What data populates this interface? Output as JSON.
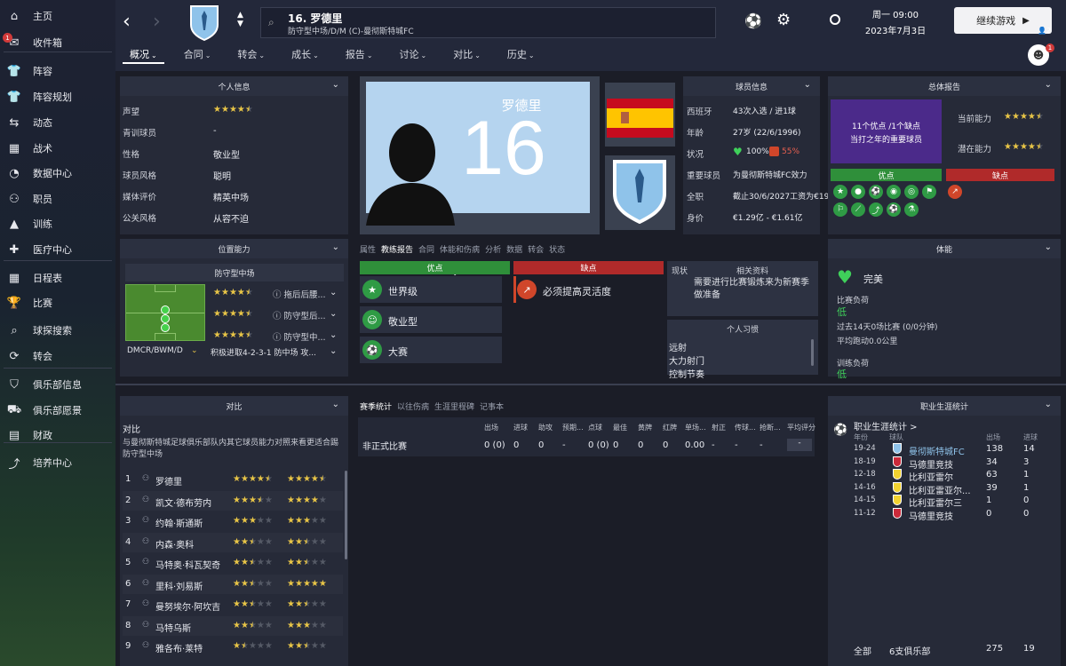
{
  "sidebar": [
    {
      "label": "主页",
      "icon": "home-icon",
      "glyph": "⌂"
    },
    {
      "label": "收件箱",
      "icon": "inbox-icon",
      "glyph": "✉",
      "badge": "1"
    },
    {
      "label": "阵容",
      "icon": "squad-icon",
      "glyph": "👕"
    },
    {
      "label": "阵容规划",
      "icon": "squad-planner-icon",
      "glyph": "👕"
    },
    {
      "label": "动态",
      "icon": "dynamics-icon",
      "glyph": "⇆"
    },
    {
      "label": "战术",
      "icon": "tactics-icon",
      "glyph": "▦"
    },
    {
      "label": "数据中心",
      "icon": "data-hub-icon",
      "glyph": "◔"
    },
    {
      "label": "职员",
      "icon": "staff-icon",
      "glyph": "⚇"
    },
    {
      "label": "训练",
      "icon": "training-icon",
      "glyph": "▲"
    },
    {
      "label": "医疗中心",
      "icon": "medical-icon",
      "glyph": "✚"
    },
    {
      "label": "日程表",
      "icon": "calendar-icon",
      "glyph": "▦"
    },
    {
      "label": "比赛",
      "icon": "trophy-icon",
      "glyph": "🏆"
    },
    {
      "label": "球探搜索",
      "icon": "scouting-icon",
      "glyph": "⌕"
    },
    {
      "label": "转会",
      "icon": "transfers-icon",
      "glyph": "⟳"
    },
    {
      "label": "俱乐部信息",
      "icon": "club-info-icon",
      "glyph": "⛉"
    },
    {
      "label": "俱乐部愿景",
      "icon": "club-vision-icon",
      "glyph": "⛟"
    },
    {
      "label": "财政",
      "icon": "finances-icon",
      "glyph": "▤"
    },
    {
      "label": "培养中心",
      "icon": "development-icon",
      "glyph": "⤴"
    }
  ],
  "header": {
    "player_name": "16. 罗德里",
    "player_sub": "防守型中场/D/M (C)-曼彻斯特城FC",
    "date_day": "周一 09:00",
    "date_full": "2023年7月3日",
    "continue": "继续游戏",
    "tabs": [
      "概况",
      "合同",
      "转会",
      "成长",
      "报告",
      "讨论",
      "对比",
      "历史"
    ]
  },
  "personal": {
    "title": "个人信息",
    "rows": [
      {
        "label": "声望",
        "value": "",
        "stars": 4.5
      },
      {
        "label": "青训球员",
        "value": "-"
      },
      {
        "label": "性格",
        "value": "敬业型"
      },
      {
        "label": "球员风格",
        "value": "聪明"
      },
      {
        "label": "媒体评价",
        "value": "精英中场"
      },
      {
        "label": "公关风格",
        "value": "从容不迫"
      }
    ]
  },
  "portrait": {
    "shirt_name": "罗德里",
    "shirt_number": "16"
  },
  "player_info": {
    "title": "球员信息",
    "rows": [
      {
        "label": "西班牙",
        "value": "43次入选 / 进1球"
      },
      {
        "label": "年龄",
        "value": "27岁 (22/6/1996)"
      },
      {
        "label": "状况",
        "value": "100%",
        "value2": "55%"
      },
      {
        "label": "重要球员",
        "value": "为曼彻斯特城FC效力"
      },
      {
        "label": "全职",
        "value": "截止30/6/2027工资为€19万/周"
      },
      {
        "label": "身价",
        "value": "€1.29亿 - €1.61亿"
      }
    ]
  },
  "overall": {
    "title": "总体报告",
    "purple_line1": "11个优点 /1个缺点",
    "purple_line2": "当打之年的重要球员",
    "current_label": "当前能力",
    "potential_label": "潜在能力",
    "current_stars": 4.5,
    "potential_stars": 4.5,
    "good": "优点",
    "bad": "缺点"
  },
  "position": {
    "title": "位置能力",
    "select": "防守型中场",
    "rows": [
      {
        "stars": 4.5,
        "role": "拖后后腰..."
      },
      {
        "stars": 4.5,
        "role": "防守型后..."
      },
      {
        "stars": 4.5,
        "role": "防守型中..."
      }
    ],
    "footer_pos": "DMCR/BWM/D",
    "footer_tac": "积极进取4-2-3-1 防中场 攻..."
  },
  "coach": {
    "tabs": [
      "属性",
      "教练报告",
      "合同",
      "体能和伤病",
      "分析",
      "数据",
      "转会",
      "状态"
    ],
    "active": "教练报告",
    "good": "优点",
    "bad": "缺点",
    "goods": [
      "世界级",
      "敬业型",
      "大赛"
    ],
    "bads": [
      "必须提高灵活度"
    ],
    "status_label": "现状",
    "related_label": "相关资料",
    "related_text": "需要进行比赛锻炼来为新赛季做准备",
    "habits_title": "个人习惯",
    "habits": [
      "远射",
      "大力射门",
      "控制节奏"
    ]
  },
  "fitness": {
    "title": "体能",
    "condition": "完美",
    "match_load_label": "比赛负荷",
    "match_load": "低",
    "line1": "过去14天0场比赛 (0/0分钟)",
    "line2": "平均跑动0.0公里",
    "training_load_label": "训练负荷",
    "training_load": "低"
  },
  "compare": {
    "title": "对比",
    "heading": "对比",
    "desc": "与曼彻斯特城足球俱乐部队内其它球员能力对照来看更适合踢防守型中场",
    "players": [
      {
        "rank": "1",
        "name": "罗德里",
        "s1": 4.5,
        "s2": 4.5
      },
      {
        "rank": "2",
        "name": "凯文·德布劳内",
        "s1": 3.5,
        "s2": 4
      },
      {
        "rank": "3",
        "name": "约翰·斯通斯",
        "s1": 3,
        "s2": 3
      },
      {
        "rank": "4",
        "name": "内森·奥科",
        "s1": 2.5,
        "s2": 2.5
      },
      {
        "rank": "5",
        "name": "马特奥·科瓦契奇",
        "s1": 2.5,
        "s2": 2.5
      },
      {
        "rank": "6",
        "name": "里科·刘易斯",
        "s1": 2.5,
        "s2": 5
      },
      {
        "rank": "7",
        "name": "曼努埃尔·阿坎吉",
        "s1": 2.5,
        "s2": 2.5
      },
      {
        "rank": "8",
        "name": "马特乌斯",
        "s1": 2.5,
        "s2": 3
      },
      {
        "rank": "9",
        "name": "雅各布·莱特",
        "s1": 1.5,
        "s2": 2.5
      }
    ]
  },
  "season": {
    "tabs": [
      "赛季统计",
      "以往伤病",
      "生涯里程碑",
      "记事本"
    ],
    "active": "赛季统计",
    "headers": [
      "出场",
      "进球",
      "助攻",
      "预期...",
      "点球",
      "最佳",
      "黄牌",
      "红牌",
      "单场...",
      "射正",
      "传球...",
      "抢断...",
      "平均评分"
    ],
    "row_label": "非正式比赛",
    "row": [
      "0 (0)",
      "0",
      "0",
      "-",
      "0 (0)",
      "0",
      "0",
      "0",
      "0.00",
      "-",
      "-",
      "-",
      "-"
    ]
  },
  "career": {
    "title": "职业生涯统计",
    "heading": "职业生涯统计 >",
    "col_year": "年份",
    "col_team": "球队",
    "col_apps": "出场",
    "col_goals": "进球",
    "rows": [
      {
        "year": "19-24",
        "team": "曼彻斯特城FC",
        "apps": "138",
        "goals": "14",
        "crest": "city"
      },
      {
        "year": "18-19",
        "team": "马德里竞技",
        "apps": "34",
        "goals": "3",
        "crest": "atleti"
      },
      {
        "year": "12-18",
        "team": "比利亚雷尔",
        "apps": "63",
        "goals": "1",
        "crest": "villa"
      },
      {
        "year": "14-16",
        "team": "比利亚雷亚尔...",
        "apps": "39",
        "goals": "1",
        "crest": "villa"
      },
      {
        "year": "14-15",
        "team": "比利亚雷尔三",
        "apps": "1",
        "goals": "0",
        "crest": "villa"
      },
      {
        "year": "11-12",
        "team": "马德里竞技",
        "apps": "0",
        "goals": "0",
        "crest": "atleti"
      }
    ],
    "total_label": "全部",
    "total_clubs": "6支俱乐部",
    "total_apps": "275",
    "total_goals": "19"
  },
  "colors": {
    "accent_good": "#2f8f3a",
    "accent_bad": "#b02a2a",
    "purple": "#4b2a8a",
    "star": "#e8c547"
  }
}
